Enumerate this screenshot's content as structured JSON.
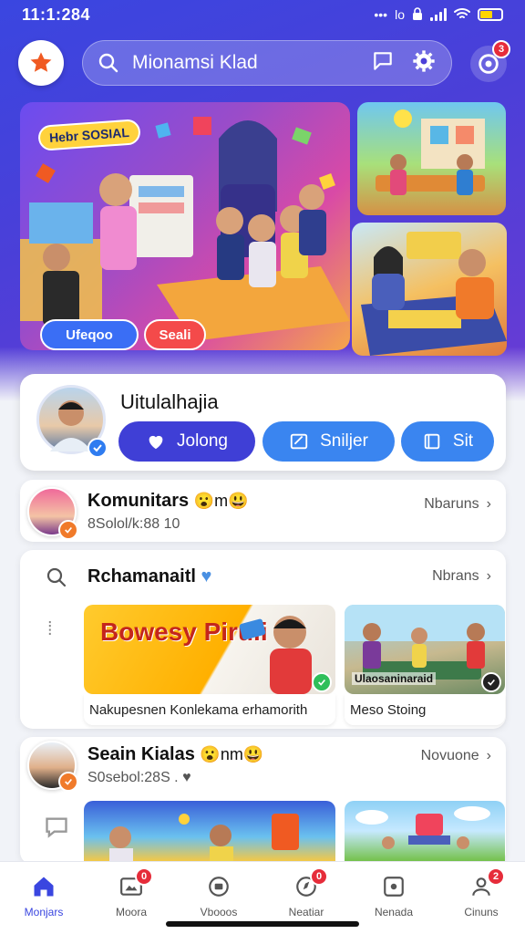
{
  "status_bar": {
    "time": "11:1:284",
    "network": "lo"
  },
  "header": {
    "search_text": "Mionamsi Klad",
    "notification_count": "3"
  },
  "hero": {
    "badge": "Hebr SOSIAL",
    "chip_primary": "Ufeqoo",
    "chip_secondary": "Seali"
  },
  "profile": {
    "name": "Uitulalhajia",
    "buttons": [
      {
        "label": "Jolong",
        "icon": "heart-icon"
      },
      {
        "label": "Sniljer",
        "icon": "edit-icon"
      },
      {
        "label": "Sit",
        "icon": "book-icon"
      }
    ]
  },
  "community": {
    "title": "Komunitars",
    "emoji": "😮m😃",
    "subtitle": "8Solol/k:88 10",
    "more_label": "Nbaruns"
  },
  "pinned": {
    "title": "Rchamanaitl",
    "more_label": "Nbrans",
    "thumb_big_text": "Bowesy Piruli",
    "items": [
      {
        "caption": "Nakupesnen Konlekama erhamorith"
      },
      {
        "caption": "Meso Stoing"
      }
    ],
    "item2_overlay": "Ulaosaninaraid"
  },
  "class": {
    "title": "Seain Kialas",
    "emoji": "😮nm😃",
    "subtitle": "S0sebol:28S . ♥",
    "more_label": "Novuone"
  },
  "bottom_nav": [
    {
      "label": "Monjars",
      "icon": "home-icon",
      "active": true,
      "badge": ""
    },
    {
      "label": "Moora",
      "icon": "media-icon",
      "active": false,
      "badge": "0"
    },
    {
      "label": "Vbooos",
      "icon": "video-icon",
      "active": false,
      "badge": ""
    },
    {
      "label": "Neatiar",
      "icon": "compass-icon",
      "active": false,
      "badge": "0"
    },
    {
      "label": "Nenada",
      "icon": "play-icon",
      "active": false,
      "badge": ""
    },
    {
      "label": "Cinuns",
      "icon": "profile-icon",
      "active": false,
      "badge": "2"
    }
  ],
  "colors": {
    "primary": "#3a46e0",
    "accent_blue": "#3a85f0",
    "notification_red": "#e62c3a",
    "logo_orange": "#f05a22"
  }
}
